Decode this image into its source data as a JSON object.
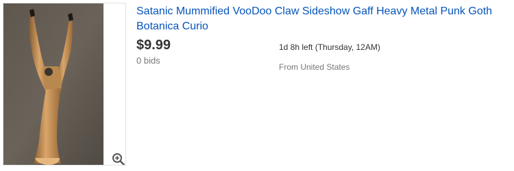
{
  "item": {
    "title": "Satanic Mummified VooDoo Claw Sideshow Gaff Heavy Metal Punk Goth Botanica Curio",
    "price": "$9.99",
    "bids": "0 bids",
    "time_left": "1d 8h left (Thursday, 12AM)",
    "location": "From United States"
  },
  "icons": {
    "zoom": "zoom-magnifier-icon"
  },
  "colors": {
    "title_link": "#0654ba",
    "price": "#333333",
    "secondary_text": "#777777"
  }
}
